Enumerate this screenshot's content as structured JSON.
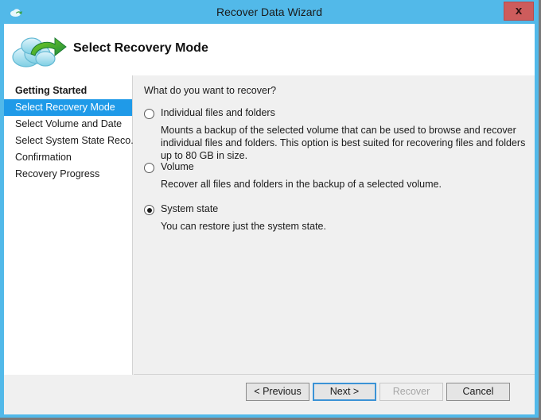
{
  "window": {
    "title": "Recover Data Wizard",
    "app_icon": "cloud-icon",
    "close_label": "x",
    "accent_color": "#52b9e9",
    "close_color": "#cd5c5c"
  },
  "banner": {
    "icon": "cloud-recovery-icon",
    "heading": "Select Recovery Mode"
  },
  "sidebar": {
    "items": [
      {
        "label": "Getting Started",
        "state": "completed"
      },
      {
        "label": "Select Recovery Mode",
        "state": "active"
      },
      {
        "label": "Select Volume and Date",
        "state": "pending"
      },
      {
        "label": "Select System State Reco...",
        "state": "pending"
      },
      {
        "label": "Confirmation",
        "state": "pending"
      },
      {
        "label": "Recovery Progress",
        "state": "pending"
      }
    ],
    "highlight_color": "#1f9ae8"
  },
  "main": {
    "question": "What do you want to recover?",
    "options": [
      {
        "label": "Individual files and folders",
        "description": "Mounts a backup of the selected volume that can be used to browse and recover individual files and folders. This option is best suited for recovering files and folders up to 80 GB in size.",
        "selected": false
      },
      {
        "label": "Volume",
        "description": "Recover all files and folders in the backup of a selected volume.",
        "selected": false
      },
      {
        "label": "System state",
        "description": "You can restore just the system state.",
        "selected": true
      }
    ]
  },
  "footer": {
    "previous_label": "< Previous",
    "next_label": "Next >",
    "recover_label": "Recover",
    "cancel_label": "Cancel",
    "next_focused": true,
    "recover_disabled": true
  }
}
